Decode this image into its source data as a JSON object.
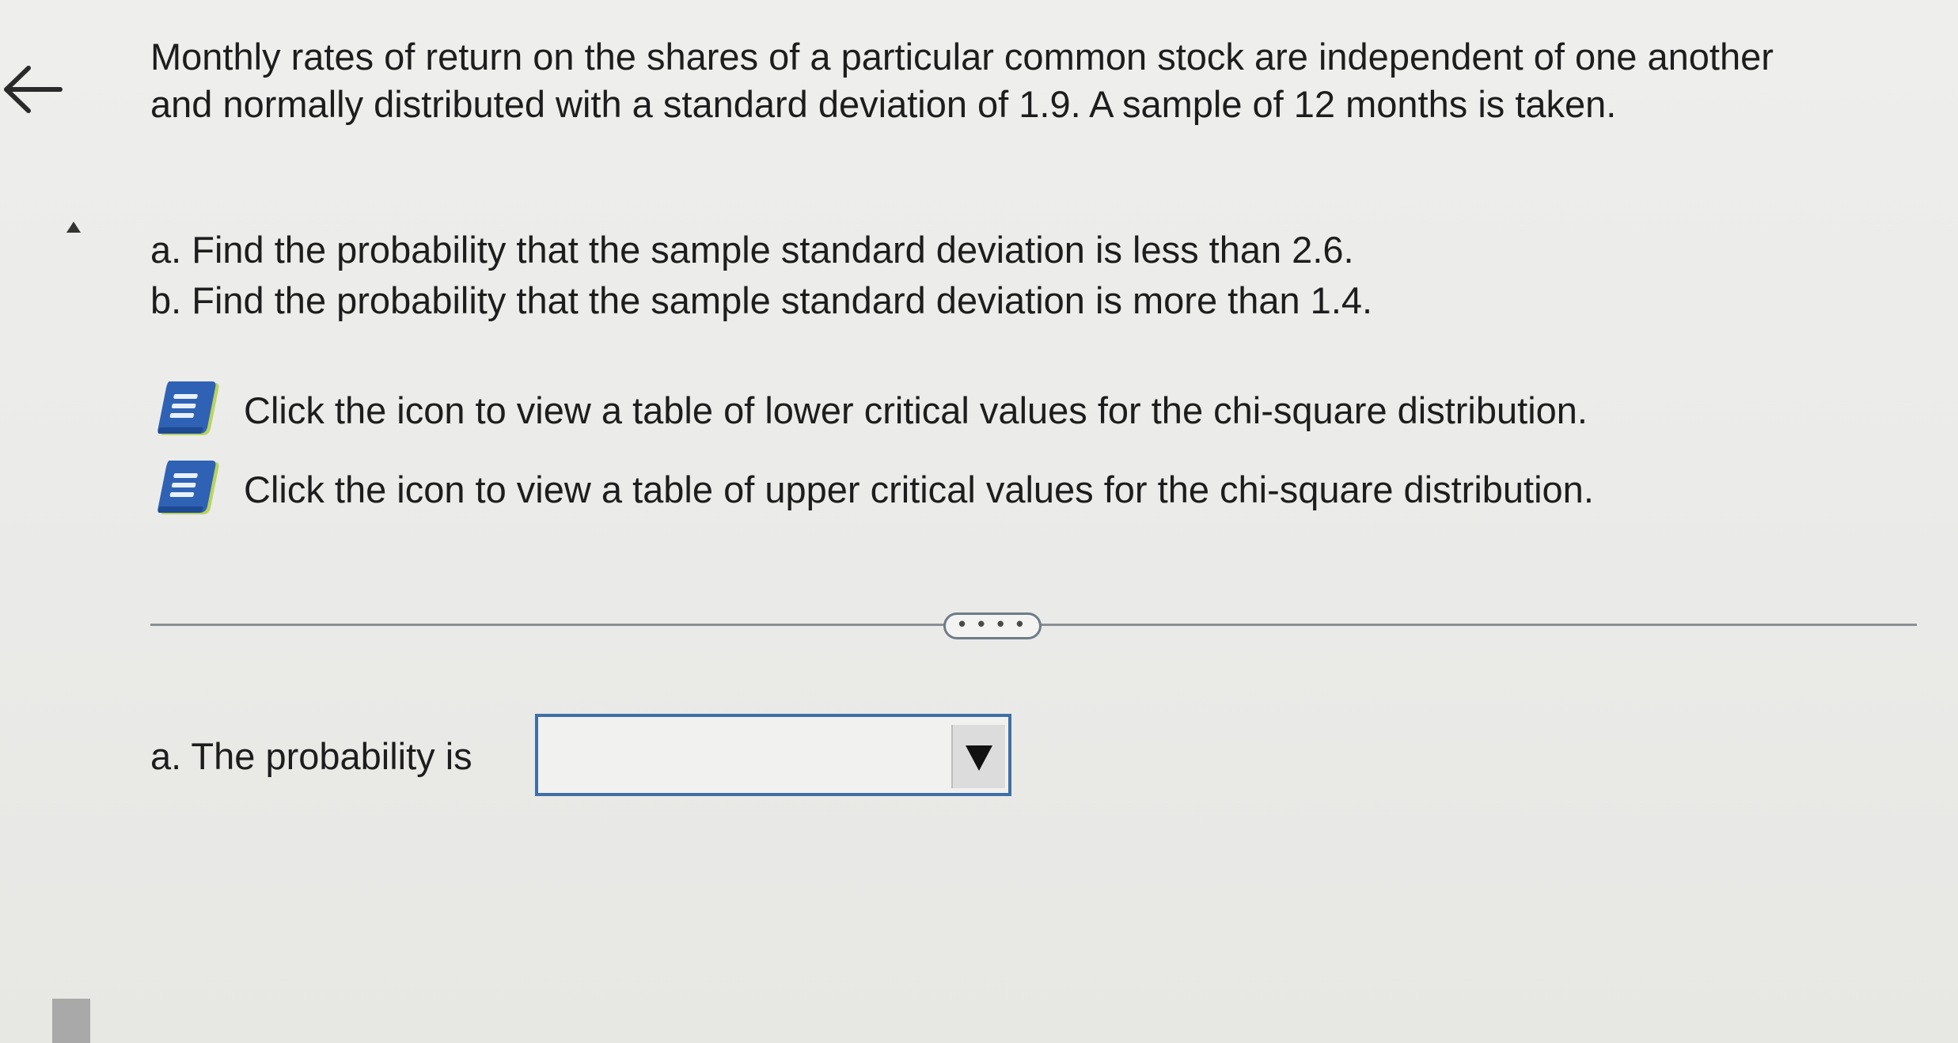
{
  "question": {
    "intro": "Monthly rates of return on the shares of a particular common stock are independent of one another and normally distributed with a standard deviation of 1.9. A sample of 12 months is taken.",
    "part_a": "a. Find the probability that the sample standard deviation is less than 2.6.",
    "part_b": "b. Find the probability that the sample standard deviation is more than 1.4."
  },
  "resources": {
    "lower_table_link": "Click the icon to view a table of lower critical values for the chi-square distribution.",
    "upper_table_link": "Click the icon to view a table of upper critical values for the chi-square distribution."
  },
  "divider": {
    "more_label": "• • • •"
  },
  "answer": {
    "label": "a. The probability is",
    "value": ""
  },
  "icons": [
    "back-arrow-icon",
    "scroll-up-icon",
    "book-icon",
    "dropdown-arrow-icon"
  ],
  "colors": {
    "book_blue": "#2f62b4",
    "book_edge": "#b9d35f",
    "input_border": "#3f6fa6"
  }
}
